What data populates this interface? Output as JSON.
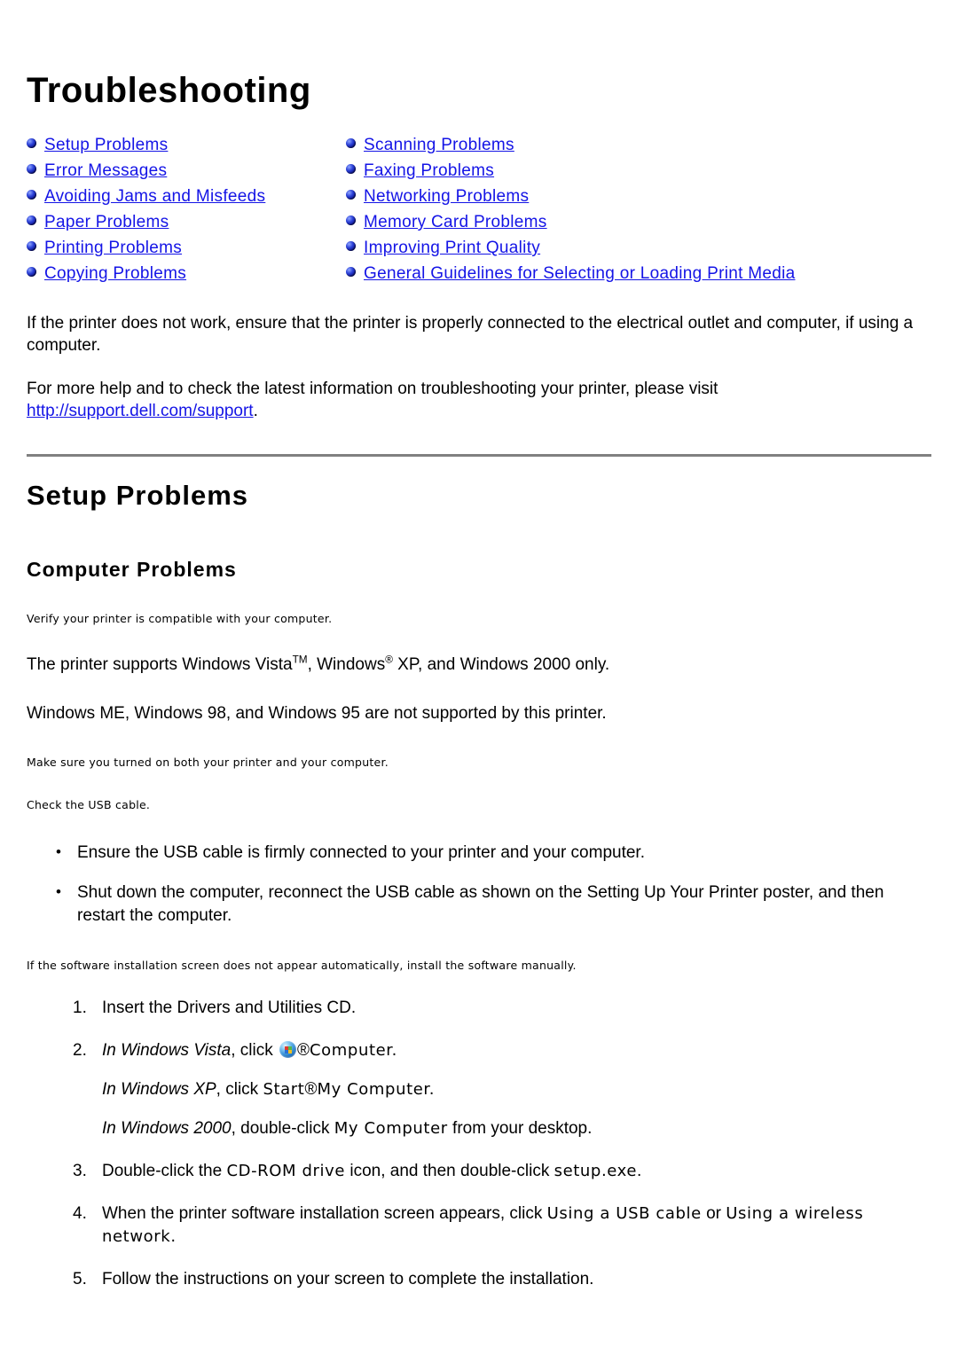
{
  "page": {
    "title": "Troubleshooting"
  },
  "toc": {
    "left": [
      {
        "label": "Setup Problems"
      },
      {
        "label": "Error Messages"
      },
      {
        "label": "Avoiding Jams and Misfeeds"
      },
      {
        "label": "Paper Problems"
      },
      {
        "label": "Printing Problems"
      },
      {
        "label": "Copying Problems"
      }
    ],
    "right": [
      {
        "label": "Scanning Problems"
      },
      {
        "label": "Faxing Problems"
      },
      {
        "label": "Networking Problems"
      },
      {
        "label": "Memory Card Problems"
      },
      {
        "label": "Improving Print Quality"
      },
      {
        "label": "General Guidelines for Selecting or Loading Print Media"
      }
    ]
  },
  "intro": {
    "paragraph1": "If the printer does not work, ensure that the printer is properly connected to the electrical outlet and computer, if using a computer.",
    "paragraph2_before": "For more help and to check the latest information on troubleshooting your printer, please visit ",
    "support_link": "http://support.dell.com/support",
    "paragraph2_after": "."
  },
  "sections": {
    "setup_problems_heading": "Setup Problems",
    "computer_problems_heading": "Computer Problems",
    "note_compatible": "Verify your printer is compatible with your computer.",
    "stmt_supported": {
      "part1": "The printer supports Windows Vista",
      "tm": "TM",
      "part2": ", Windows",
      "reg": "®",
      "part3": " XP, and Windows 2000 only."
    },
    "stmt_unsupported": "Windows ME, Windows 98, and Windows 95 are not supported by this printer.",
    "note_turned_on": "Make sure you turned on both your printer and your computer.",
    "note_usb_cable": "Check the USB cable.",
    "usb_bullets": [
      "Ensure the USB cable is firmly connected to your printer and your computer.",
      "Shut down the computer, reconnect the USB cable as shown on the Setting Up Your Printer poster, and then restart the computer."
    ],
    "note_manual_install": "If the software installation screen does not appear automatically, install the software manually.",
    "steps": {
      "step1": "Insert the Drivers and Utilities CD.",
      "step2": {
        "italic": "In Windows Vista",
        "mid": ", click ",
        "icon": "windows-vista-start-orb-icon",
        "reg": "®",
        "target": "Computer",
        "period": "."
      },
      "step2b": {
        "italic": "In Windows XP",
        "mid": ", click ",
        "target1": "Start",
        "reg": "®",
        "target2": "My Computer",
        "period": "."
      },
      "step2c": {
        "italic": "In Windows 2000",
        "mid": ", double-click ",
        "target": "My Computer",
        "after": " from your desktop."
      },
      "step3": {
        "pre": "Double-click the ",
        "ui1": "CD-ROM drive",
        "mid": " icon, and then double-click ",
        "ui2": "setup.exe",
        "post": "."
      },
      "step4": {
        "pre": "When the printer software installation screen appears, click ",
        "ui1": "Using a USB cable",
        "mid": " or ",
        "ui2": "Using a wireless network",
        "post": "."
      },
      "step5": "Follow the instructions on your screen to complete the installation."
    }
  },
  "colors": {
    "link": "#1414e6",
    "rule": "#808080",
    "bullet": "#0b1180"
  }
}
